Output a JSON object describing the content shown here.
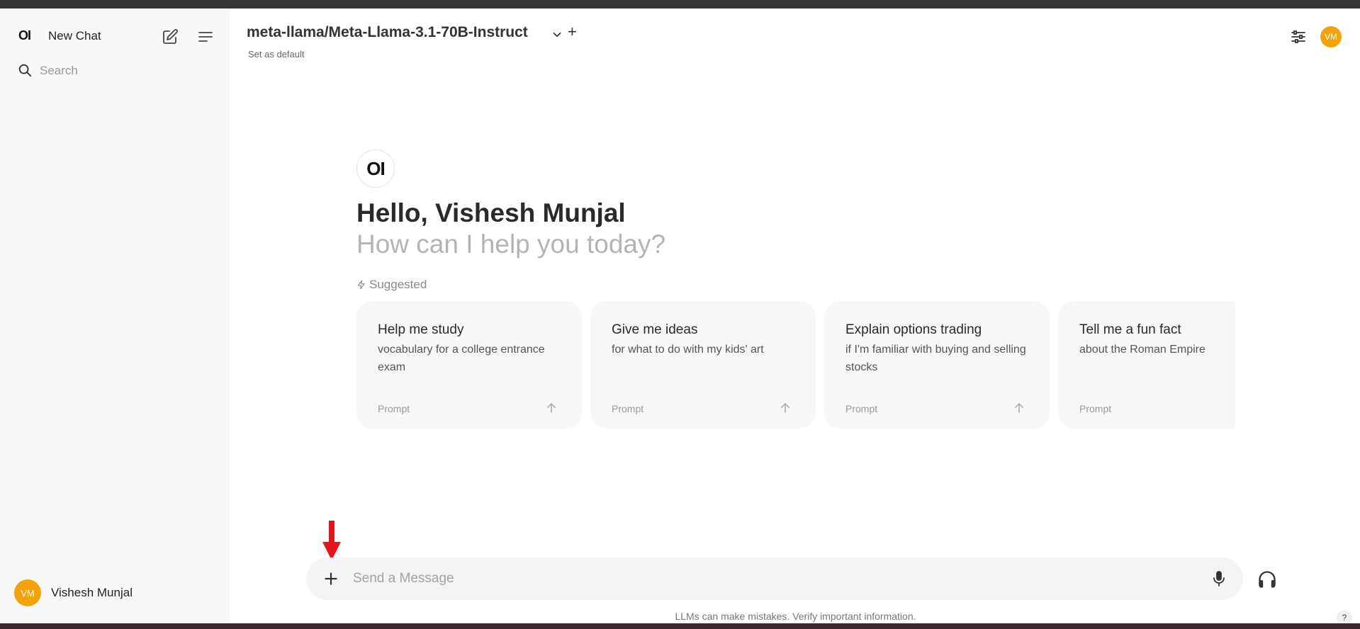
{
  "sidebar": {
    "logo": "OI",
    "new_chat_label": "New Chat",
    "search_placeholder": "Search",
    "user": {
      "initials": "VM",
      "name": "Vishesh Munjal"
    }
  },
  "header": {
    "model_name": "meta-llama/Meta-Llama-3.1-70B-Instruct",
    "add_label": "+",
    "set_default_label": "Set as default",
    "avatar_initials": "VM"
  },
  "welcome": {
    "logo": "OI",
    "greeting": "Hello, Vishesh Munjal",
    "subgreeting": "How can I help you today?",
    "suggested_label": "Suggested"
  },
  "suggestions": [
    {
      "title": "Help me study",
      "subtitle": "vocabulary for a college entrance exam",
      "prompt_label": "Prompt"
    },
    {
      "title": "Give me ideas",
      "subtitle": "for what to do with my kids' art",
      "prompt_label": "Prompt"
    },
    {
      "title": "Explain options trading",
      "subtitle": "if I'm familiar with buying and selling stocks",
      "prompt_label": "Prompt"
    },
    {
      "title": "Tell me a fun fact",
      "subtitle": "about the Roman Empire",
      "prompt_label": "Prompt"
    }
  ],
  "composer": {
    "placeholder": "Send a Message",
    "disclaimer": "LLMs can make mistakes. Verify important information.",
    "help_label": "?"
  },
  "colors": {
    "accent_avatar": "#f2a20b",
    "annotation_arrow": "#e8141c"
  }
}
